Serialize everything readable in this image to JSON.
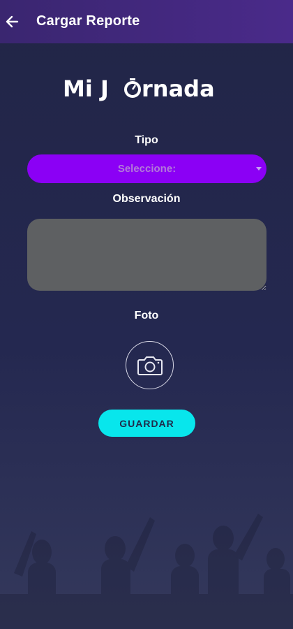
{
  "appbar": {
    "title": "Cargar Reporte",
    "back_icon": "arrow-left-icon",
    "background": "#3a2670"
  },
  "logo": {
    "text": "Mi Jornada"
  },
  "form": {
    "tipo_label": "Tipo",
    "tipo_select": {
      "placeholder": "Seleccione:",
      "color": "#8b00f5"
    },
    "observacion_label": "Observación",
    "observacion_value": "",
    "foto_label": "Foto",
    "camera_icon": "camera-icon",
    "save_label": "GUARDAR",
    "save_color": "#08e6ec"
  }
}
